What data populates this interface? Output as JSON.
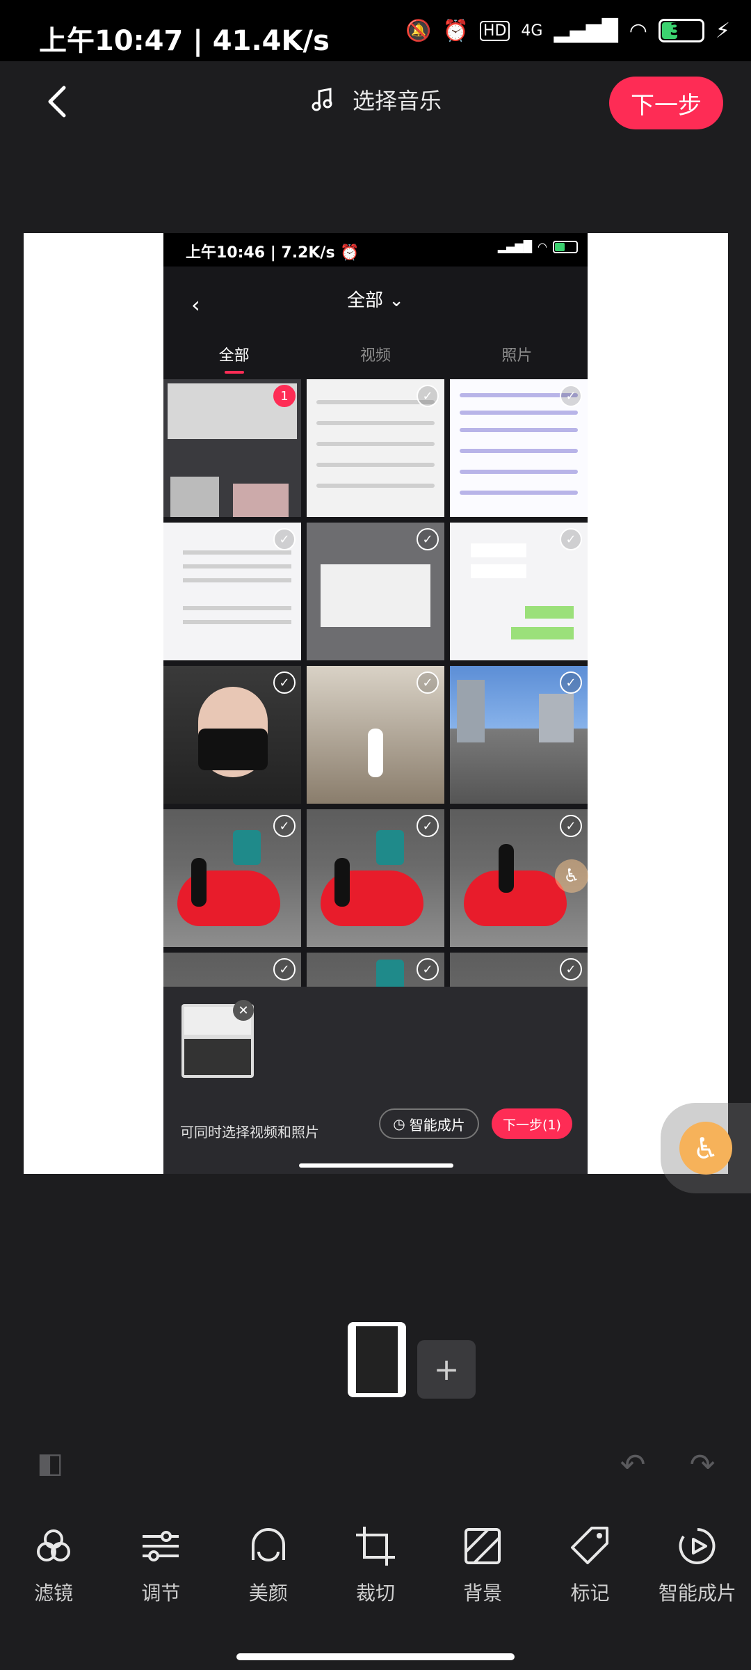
{
  "status_bar": {
    "time": "上午10:47",
    "speed": "41.4K/s",
    "battery": "39",
    "battery_level": 0.39,
    "network": "4G",
    "hd": "HD"
  },
  "header": {
    "title": "选择音乐",
    "next_label": "下一步"
  },
  "preview": {
    "status_bar": {
      "time": "上午10:46",
      "speed": "7.2K/s",
      "battery": "38"
    },
    "title": "全部",
    "tabs": [
      {
        "label": "全部",
        "active": true
      },
      {
        "label": "视频",
        "active": false
      },
      {
        "label": "照片",
        "active": false
      }
    ],
    "selected_badge": "1",
    "hint": "可同时选择视频和照片",
    "smart_label": "智能成片",
    "next_label": "下一步(1)"
  },
  "toolbar": {
    "items": [
      {
        "label": "滤镜",
        "icon": "filter-icon"
      },
      {
        "label": "调节",
        "icon": "adjust-icon"
      },
      {
        "label": "美颜",
        "icon": "beauty-icon"
      },
      {
        "label": "裁切",
        "icon": "crop-icon"
      },
      {
        "label": "背景",
        "icon": "background-icon"
      },
      {
        "label": "标记",
        "icon": "tag-icon"
      },
      {
        "label": "智能成片",
        "icon": "smart-film-icon"
      }
    ]
  },
  "colors": {
    "accent": "#fe2c55",
    "background": "#1d1d1f",
    "accessibility": "#f6b25a"
  }
}
